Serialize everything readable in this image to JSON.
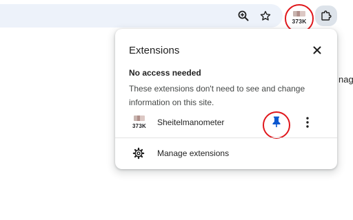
{
  "toolbar": {
    "extension_badge": "373K"
  },
  "background": {
    "fragment_text": "nag"
  },
  "popup": {
    "title": "Extensions",
    "section_heading": "No access needed",
    "section_description": "These extensions don't need to see and change information on this site.",
    "extension": {
      "badge": "373K",
      "name": "Sheitelmanometer",
      "pinned": true
    },
    "manage_label": "Manage extensions"
  },
  "colors": {
    "accent": "#0b57d0",
    "highlight_ring": "#e0161b"
  },
  "icons": [
    "zoom-in-icon",
    "star-icon",
    "puzzle-icon",
    "close-icon",
    "pin-icon",
    "more-vert-icon",
    "gear-icon"
  ]
}
